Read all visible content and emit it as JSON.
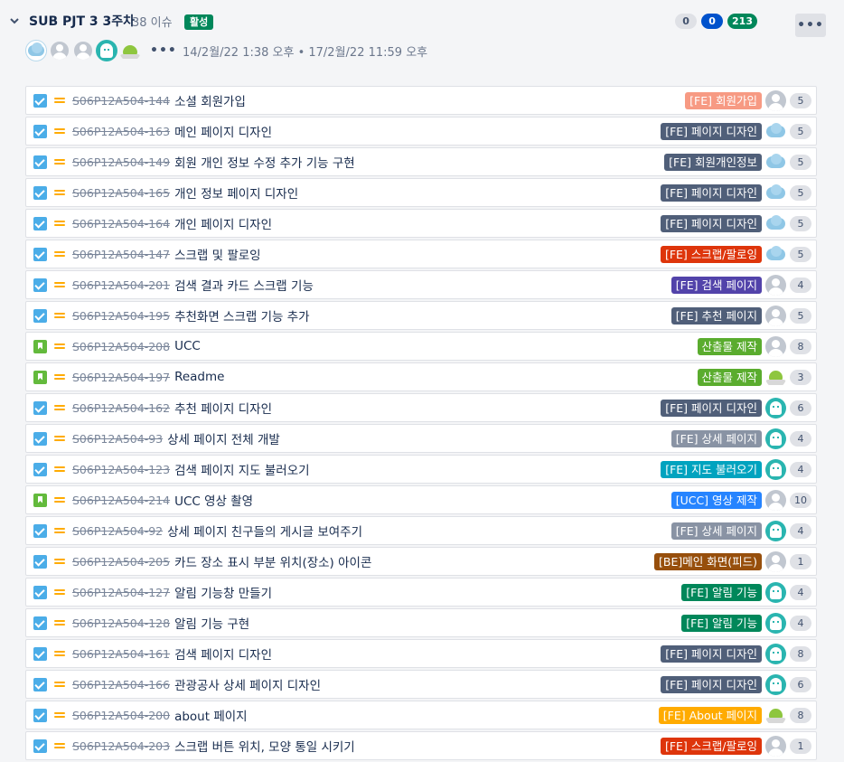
{
  "sprint": {
    "name": "SUB PJT 3 3주차",
    "issue_count": "38 이슈",
    "status": "활성",
    "dates": "14/2월/22 1:38 오후 • 17/2월/22 11:59 오후",
    "counts": {
      "todo": "0",
      "in_progress": "0",
      "done": "213"
    },
    "more_label": "•••",
    "avatar_more": "•••",
    "avatars": [
      "cloud",
      "gray",
      "gray",
      "ghost",
      "alien"
    ]
  },
  "colors": {
    "FE_member": "#f79a83",
    "FE_page": "#505f79",
    "FE_scrap": "#de350b",
    "FE_search": "#5243aa",
    "deliverable": "#5aac2e",
    "FE_detail": "#8993a4",
    "FE_map": "#00a3bf",
    "UCC_video": "#2684ff",
    "BE_main": "#974f0c",
    "FE_alarm": "#00875a",
    "FE_about": "#ffab00"
  },
  "issues": [
    {
      "type": "task",
      "key": "S06P12A504-144",
      "summary": "소셜 회원가입",
      "epic": "[FE] 회원가입",
      "epic_color": "#f79a83",
      "assignee": "gray",
      "points": "5"
    },
    {
      "type": "task",
      "key": "S06P12A504-163",
      "summary": "메인 페이지 디자인",
      "epic": "[FE] 페이지 디자인",
      "epic_color": "#505f79",
      "assignee": "cloud",
      "points": "5"
    },
    {
      "type": "task",
      "key": "S06P12A504-149",
      "summary": "회원 개인 정보 수정 추가 기능 구현",
      "epic": "[FE] 회원개인정보",
      "epic_color": "#505f79",
      "assignee": "cloud",
      "points": "5"
    },
    {
      "type": "task",
      "key": "S06P12A504-165",
      "summary": "개인 정보 페이지 디자인",
      "epic": "[FE] 페이지 디자인",
      "epic_color": "#505f79",
      "assignee": "cloud",
      "points": "5"
    },
    {
      "type": "task",
      "key": "S06P12A504-164",
      "summary": "개인 페이지 디자인",
      "epic": "[FE] 페이지 디자인",
      "epic_color": "#505f79",
      "assignee": "cloud",
      "points": "5"
    },
    {
      "type": "task",
      "key": "S06P12A504-147",
      "summary": "스크랩 및 팔로잉",
      "epic": "[FE] 스크랩/팔로잉",
      "epic_color": "#de350b",
      "assignee": "cloud",
      "points": "5"
    },
    {
      "type": "task",
      "key": "S06P12A504-201",
      "summary": "검색 결과 카드 스크랩 기능",
      "epic": "[FE] 검색 페이지",
      "epic_color": "#5243aa",
      "assignee": "gray",
      "points": "4"
    },
    {
      "type": "task",
      "key": "S06P12A504-195",
      "summary": "추천화면 스크랩 기능 추가",
      "epic": "[FE] 추천 페이지",
      "epic_color": "#505f79",
      "assignee": "gray",
      "points": "5"
    },
    {
      "type": "story",
      "key": "S06P12A504-208",
      "summary": "UCC",
      "epic": "산출물 제작",
      "epic_color": "#5aac2e",
      "assignee": "gray",
      "points": "8"
    },
    {
      "type": "story",
      "key": "S06P12A504-197",
      "summary": "Readme",
      "epic": "산출물 제작",
      "epic_color": "#5aac2e",
      "assignee": "alien",
      "points": "3"
    },
    {
      "type": "task",
      "key": "S06P12A504-162",
      "summary": "추천 페이지 디자인",
      "epic": "[FE] 페이지 디자인",
      "epic_color": "#505f79",
      "assignee": "ghost",
      "points": "6"
    },
    {
      "type": "task",
      "key": "S06P12A504-93",
      "summary": "상세 페이지 전체 개발",
      "epic": "[FE] 상세 페이지",
      "epic_color": "#8993a4",
      "assignee": "ghost",
      "points": "4"
    },
    {
      "type": "task",
      "key": "S06P12A504-123",
      "summary": "검색 페이지 지도 불러오기",
      "epic": "[FE] 지도 불러오기",
      "epic_color": "#00a3bf",
      "assignee": "ghost",
      "points": "4"
    },
    {
      "type": "story",
      "key": "S06P12A504-214",
      "summary": "UCC 영상 촬영",
      "epic": "[UCC] 영상 제작",
      "epic_color": "#2684ff",
      "assignee": "gray",
      "points": "10"
    },
    {
      "type": "task",
      "key": "S06P12A504-92",
      "summary": "상세 페이지 친구들의 게시글 보여주기",
      "epic": "[FE] 상세 페이지",
      "epic_color": "#8993a4",
      "assignee": "ghost",
      "points": "4"
    },
    {
      "type": "task",
      "key": "S06P12A504-205",
      "summary": "카드 장소 표시 부분 위치(장소) 아이콘",
      "epic": "[BE]메인 화면(피드)",
      "epic_color": "#974f0c",
      "assignee": "gray",
      "points": "1"
    },
    {
      "type": "task",
      "key": "S06P12A504-127",
      "summary": "알림 기능창 만들기",
      "epic": "[FE] 알림 기능",
      "epic_color": "#00875a",
      "assignee": "ghost",
      "points": "4"
    },
    {
      "type": "task",
      "key": "S06P12A504-128",
      "summary": "알림 기능 구현",
      "epic": "[FE] 알림 기능",
      "epic_color": "#00875a",
      "assignee": "ghost",
      "points": "4"
    },
    {
      "type": "task",
      "key": "S06P12A504-161",
      "summary": "검색 페이지 디자인",
      "epic": "[FE] 페이지 디자인",
      "epic_color": "#505f79",
      "assignee": "ghost",
      "points": "8"
    },
    {
      "type": "task",
      "key": "S06P12A504-166",
      "summary": "관광공사 상세 페이지 디자인",
      "epic": "[FE] 페이지 디자인",
      "epic_color": "#505f79",
      "assignee": "ghost",
      "points": "6"
    },
    {
      "type": "task",
      "key": "S06P12A504-200",
      "summary": "about 페이지",
      "epic": "[FE] About 페이지",
      "epic_color": "#ffab00",
      "assignee": "alien",
      "points": "8"
    },
    {
      "type": "task",
      "key": "S06P12A504-203",
      "summary": "스크랩 버튼 위치, 모양 통일 시키기",
      "epic": "[FE] 스크랩/팔로잉",
      "epic_color": "#de350b",
      "assignee": "gray",
      "points": "1"
    }
  ]
}
